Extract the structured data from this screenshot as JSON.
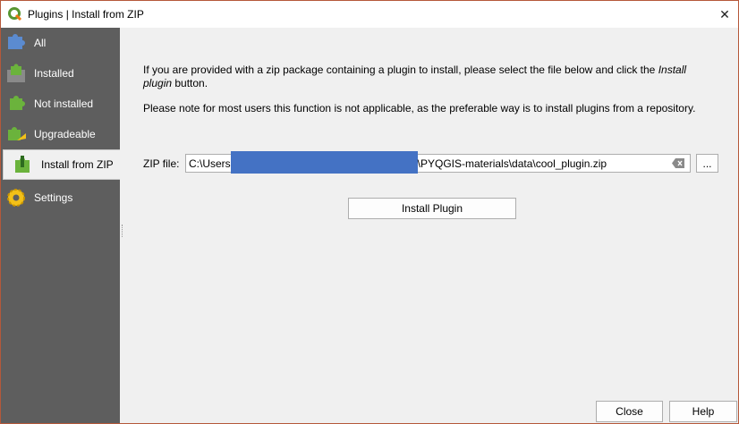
{
  "window": {
    "title": "Plugins | Install from ZIP",
    "close_glyph": "✕"
  },
  "sidebar": {
    "items": [
      {
        "label": "All",
        "icon": "puzzle-all-icon"
      },
      {
        "label": "Installed",
        "icon": "puzzle-installed-icon"
      },
      {
        "label": "Not installed",
        "icon": "puzzle-not-installed-icon"
      },
      {
        "label": "Upgradeable",
        "icon": "puzzle-upgradeable-icon"
      },
      {
        "label": "Install from ZIP",
        "icon": "puzzle-zip-icon",
        "active": true
      },
      {
        "label": "Settings",
        "icon": "gear-icon"
      }
    ]
  },
  "content": {
    "para1_text": "If you are provided with a zip package containing a plugin to install, please select the file below and click the ",
    "para1_emph": "Install plugin",
    "para1_tail": " button.",
    "para2": "Please note for most users this function is not applicable, as the preferable way is to install plugins from a repository.",
    "zip_label": "ZIP file:",
    "zip_value_prefix": "C:\\Users",
    "zip_value_suffix": "\\PYQGIS-materials\\data\\cool_plugin.zip",
    "browse_label": "...",
    "install_button": "Install Plugin"
  },
  "footer": {
    "close_button": "Close",
    "help_button": "Help"
  },
  "colors": {
    "sidebar_bg": "#5e5e5e",
    "redaction": "#4472c4",
    "puzzle_green": "#6bb33c",
    "gear_yellow": "#f2c018"
  }
}
